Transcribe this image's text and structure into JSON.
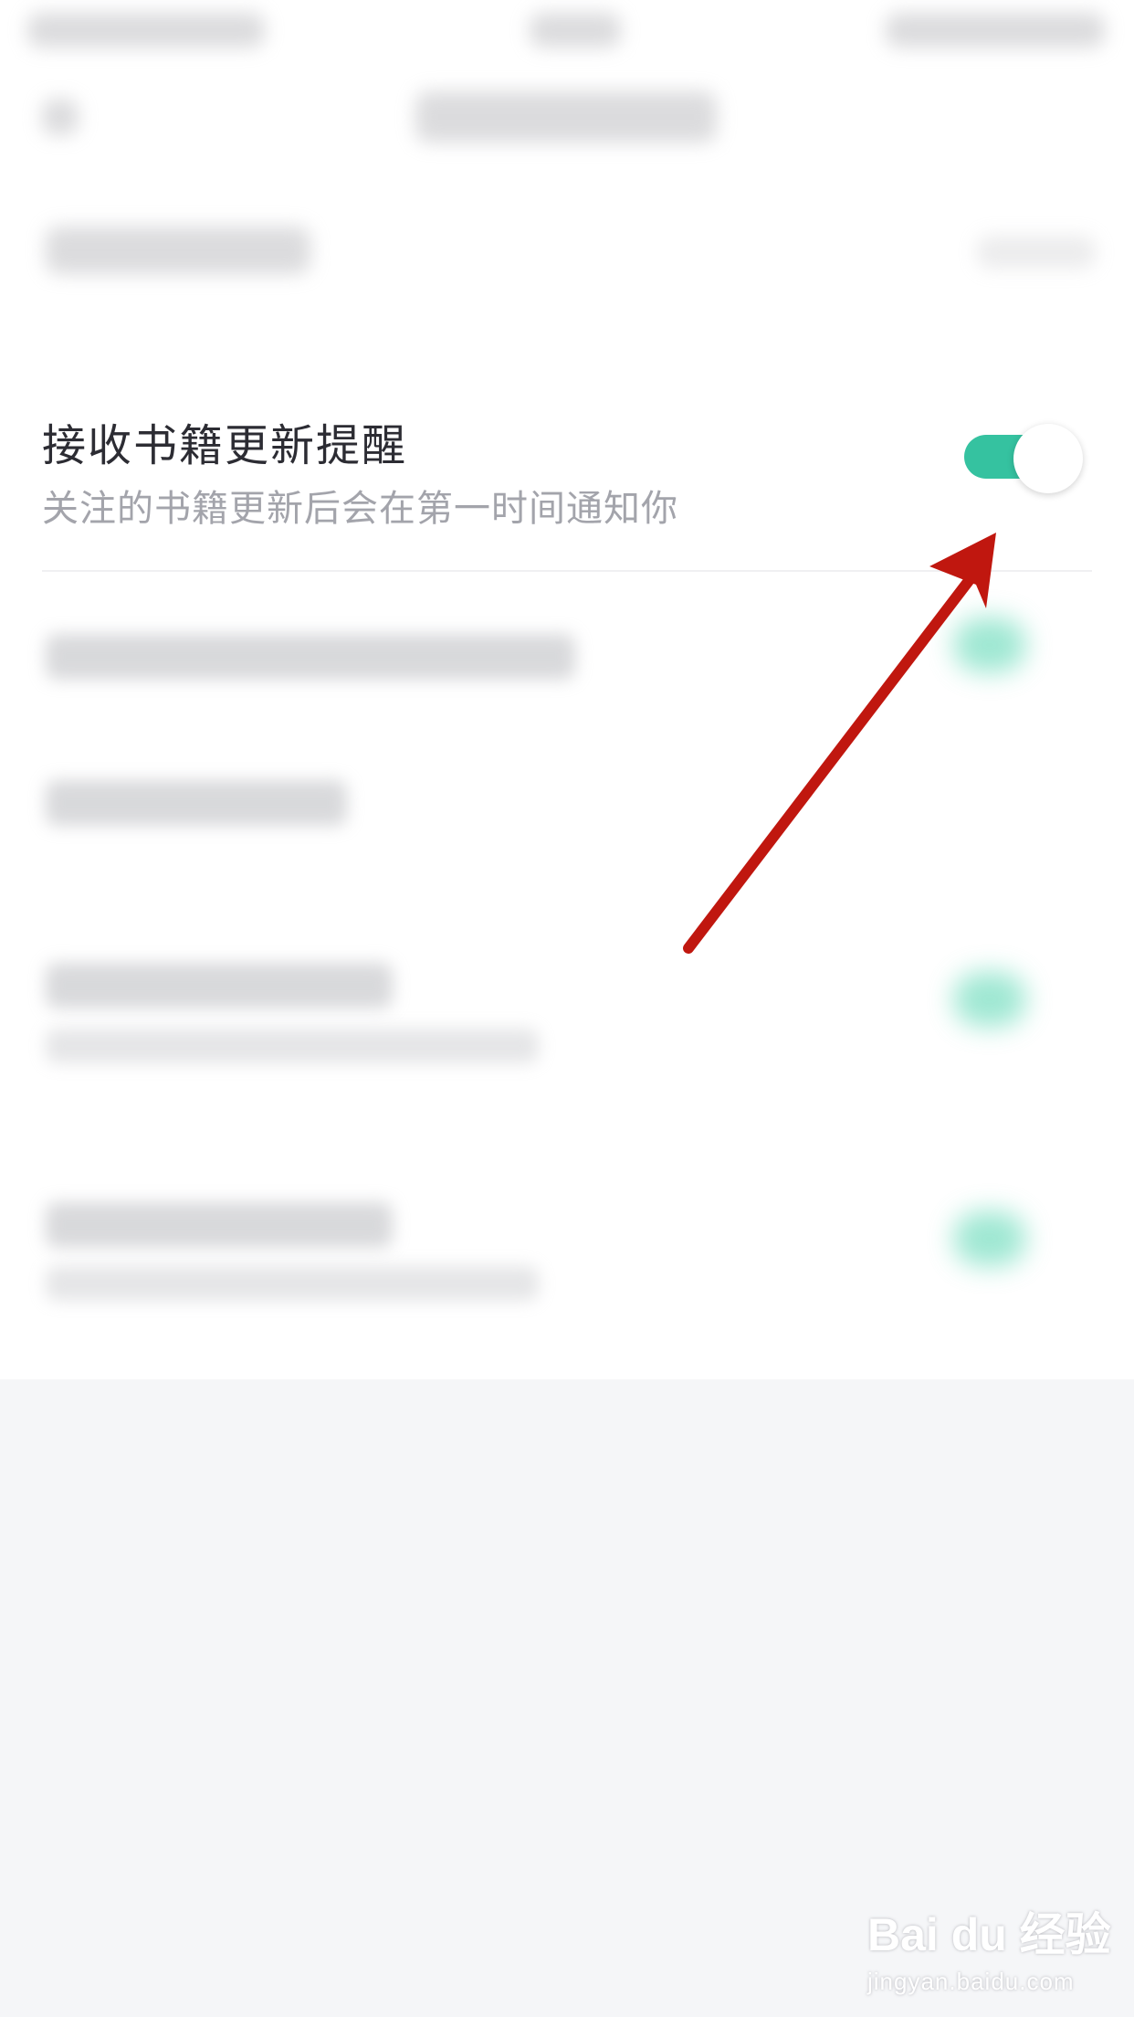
{
  "setting_row": {
    "title": "接收书籍更新提醒",
    "subtitle": "关注的书籍更新后会在第一时间通知你",
    "toggle_on": true
  },
  "watermark": {
    "logo": "Bai du 经验",
    "url": "jingyan.baidu.com"
  },
  "colors": {
    "toggle_on": "#35c2a0",
    "arrow": "#c0170f",
    "page_background": "#f5f6f8"
  }
}
